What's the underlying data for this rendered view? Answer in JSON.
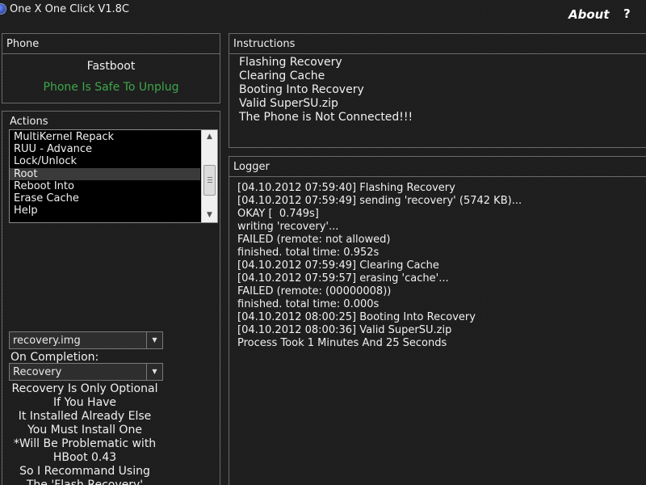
{
  "window": {
    "title": "One X One Click V1.8C",
    "about_label": "About",
    "help_label": "?"
  },
  "phone": {
    "header": "Phone",
    "mode": "Fastboot",
    "status": "Phone Is Safe To Unplug",
    "status_color": "#3ea64a"
  },
  "actions": {
    "header": "Actions",
    "items": [
      "MultiKernel Repack",
      "RUU - Advance",
      "Lock/Unlock",
      "Root",
      "Reboot Into",
      "Erase Cache",
      "Help"
    ],
    "selected_item": "Root",
    "recovery_file": "recovery.img",
    "on_completion_label": "On Completion:",
    "on_completion_value": "Recovery",
    "note_lines": [
      "Recovery Is Only Optional",
      "If You Have",
      "It Installed Already Else",
      "You Must Install One",
      "*Will Be Problematic with",
      "HBoot 0.43",
      "So I Recommand Using",
      "The 'Flash Recovery'"
    ]
  },
  "instructions": {
    "header": "Instructions",
    "items": [
      "Flashing Recovery",
      "Clearing Cache",
      "Booting Into Recovery",
      "Valid SuperSU.zip",
      "The Phone is Not Connected!!!"
    ]
  },
  "logger": {
    "header": "Logger",
    "lines": [
      "[04.10.2012 07:59:40] Flashing Recovery",
      "[04.10.2012 07:59:49] sending 'recovery' (5742 KB)...",
      "OKAY [  0.749s]",
      "writing 'recovery'...",
      "FAILED (remote: not allowed)",
      "finished. total time: 0.952s",
      "[04.10.2012 07:59:49] Clearing Cache",
      "[04.10.2012 07:59:57] erasing 'cache'...",
      "FAILED (remote: (00000008))",
      "finished. total time: 0.000s",
      "[04.10.2012 08:00:25] Booting Into Recovery",
      "[04.10.2012 08:00:36] Valid SuperSU.zip",
      "Process Took 1 Minutes And 25 Seconds"
    ]
  },
  "icons": {
    "app": "app-icon",
    "combo_arrow": "chevron-down-icon",
    "scroll_up": "scroll-up-arrow-icon",
    "scroll_down": "scroll-down-arrow-icon"
  }
}
